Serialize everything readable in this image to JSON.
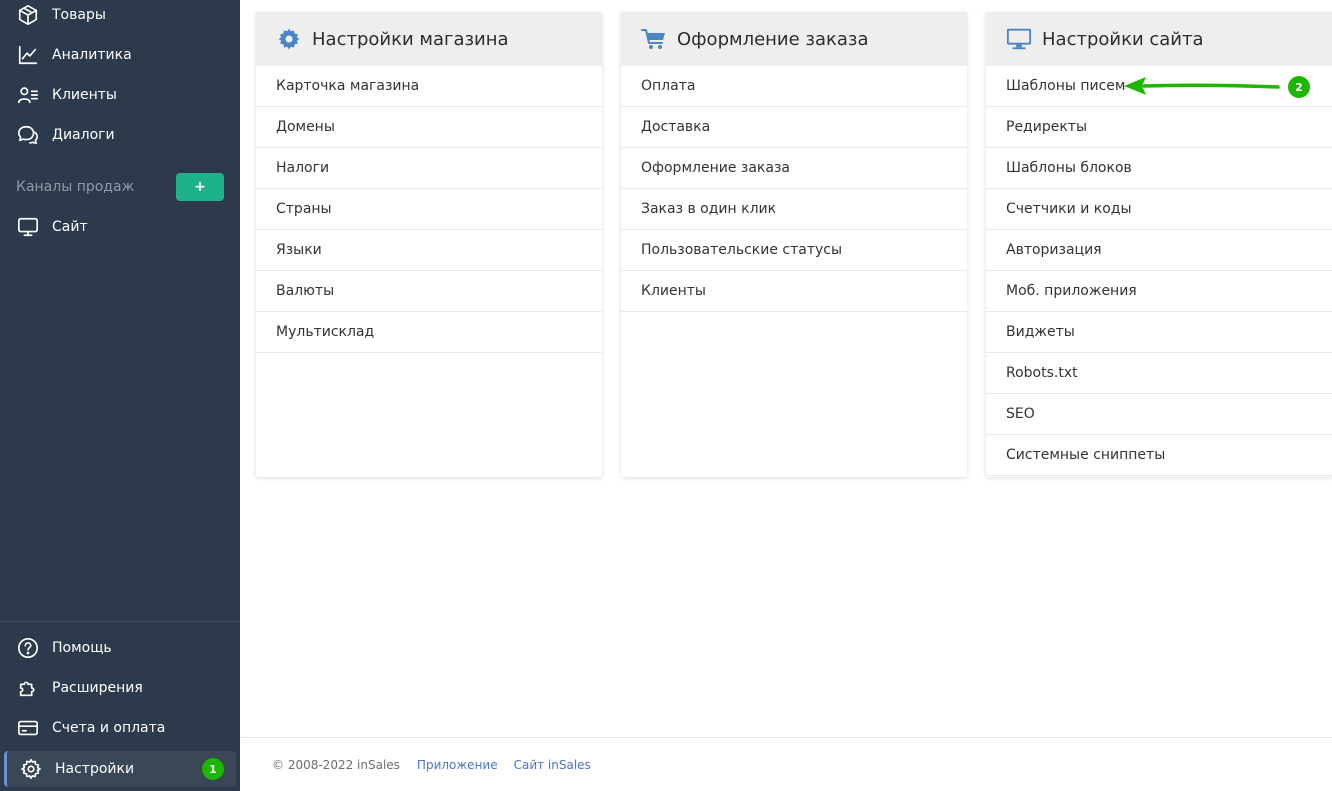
{
  "sidebar": {
    "top_items": [
      {
        "label": "Товары",
        "icon": "box-icon"
      },
      {
        "label": "Аналитика",
        "icon": "chart-line-icon"
      },
      {
        "label": "Клиенты",
        "icon": "clients-icon"
      },
      {
        "label": "Диалоги",
        "icon": "chat-icon"
      }
    ],
    "channels_label": "Каналы продаж",
    "channels_add": "+",
    "channel_items": [
      {
        "label": "Сайт",
        "icon": "monitor-icon"
      }
    ],
    "bottom_items": [
      {
        "label": "Помощь",
        "icon": "help-icon"
      },
      {
        "label": "Расширения",
        "icon": "puzzle-icon"
      },
      {
        "label": "Счета и оплата",
        "icon": "card-icon"
      },
      {
        "label": "Настройки",
        "icon": "gear-icon",
        "active": true,
        "badge": "1"
      }
    ]
  },
  "cards": [
    {
      "title": "Настройки магазина",
      "icon": "gear-icon",
      "items": [
        "Карточка магазина",
        "Домены",
        "Налоги",
        "Страны",
        "Языки",
        "Валюты",
        "Мультисклад"
      ]
    },
    {
      "title": "Оформление заказа",
      "icon": "cart-icon",
      "items": [
        "Оплата",
        "Доставка",
        "Оформление заказа",
        "Заказ в один клик",
        "Пользовательские статусы",
        "Клиенты"
      ]
    },
    {
      "title": "Настройки сайта",
      "icon": "monitor-icon",
      "items": [
        "Шаблоны писем",
        "Редиректы",
        "Шаблоны блоков",
        "Счетчики и коды",
        "Авторизация",
        "Моб. приложения",
        "Виджеты",
        "Robots.txt",
        "SEO",
        "Системные сниппеты"
      ]
    }
  ],
  "annotation": {
    "badge": "2",
    "color": "#1db600"
  },
  "footer": {
    "copyright": "© 2008-2022 inSales",
    "links": [
      "Приложение",
      "Сайт inSales"
    ]
  },
  "colors": {
    "sidebar_bg": "#2c3a4b",
    "accent_green": "#1fb28a",
    "badge_green": "#1db600",
    "link_blue": "#4a76c5",
    "icon_blue": "#4a86c5"
  }
}
